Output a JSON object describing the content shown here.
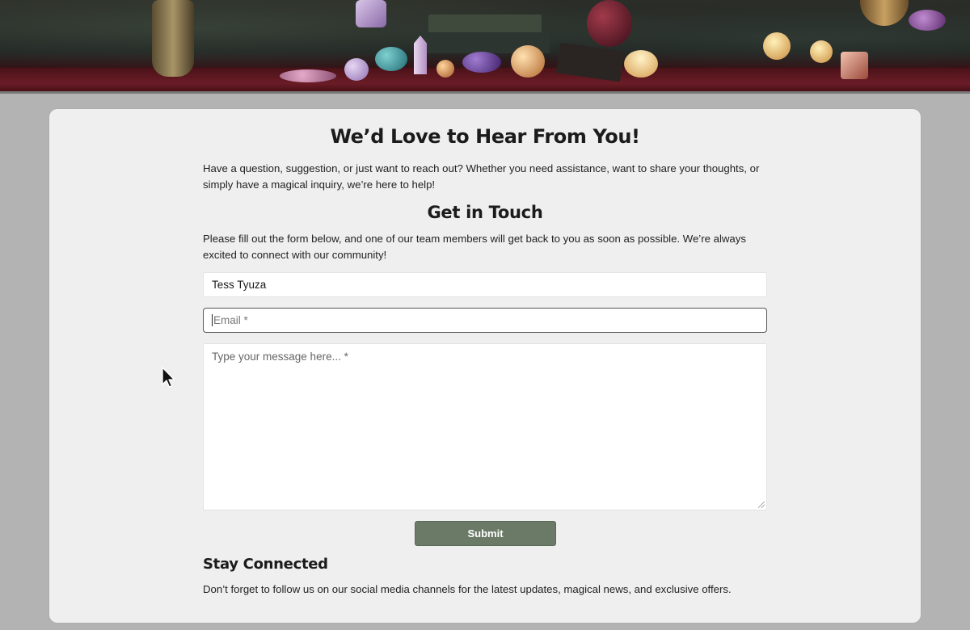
{
  "banner": {
    "image": "crystals-and-candles-banner"
  },
  "contact": {
    "title": "We’d Love to Hear From You!",
    "intro": "Have a question, suggestion, or just want to reach out? Whether you need assistance, want to share your thoughts, or simply have a magical inquiry, we’re here to help!",
    "form_heading": "Get in Touch",
    "form_text": "Please fill out the form below, and one of our team members will get back to you as soon as possible. We’re always excited to connect with our community!",
    "form": {
      "name_value": "Tess Tyuza",
      "email_placeholder": "Email *",
      "email_value": "",
      "message_placeholder": "Type your message here... *",
      "submit_label": "Submit"
    },
    "stay_heading": "Stay Connected",
    "stay_text": "Don’t forget to follow us on our social media channels for the latest updates, magical news, and exclusive offers."
  },
  "colors": {
    "page_background": "#b3b3b3",
    "card_background": "#efefef",
    "submit_button": "#6a7a66"
  },
  "cursor": {
    "icon": "arrow-cursor-icon"
  }
}
